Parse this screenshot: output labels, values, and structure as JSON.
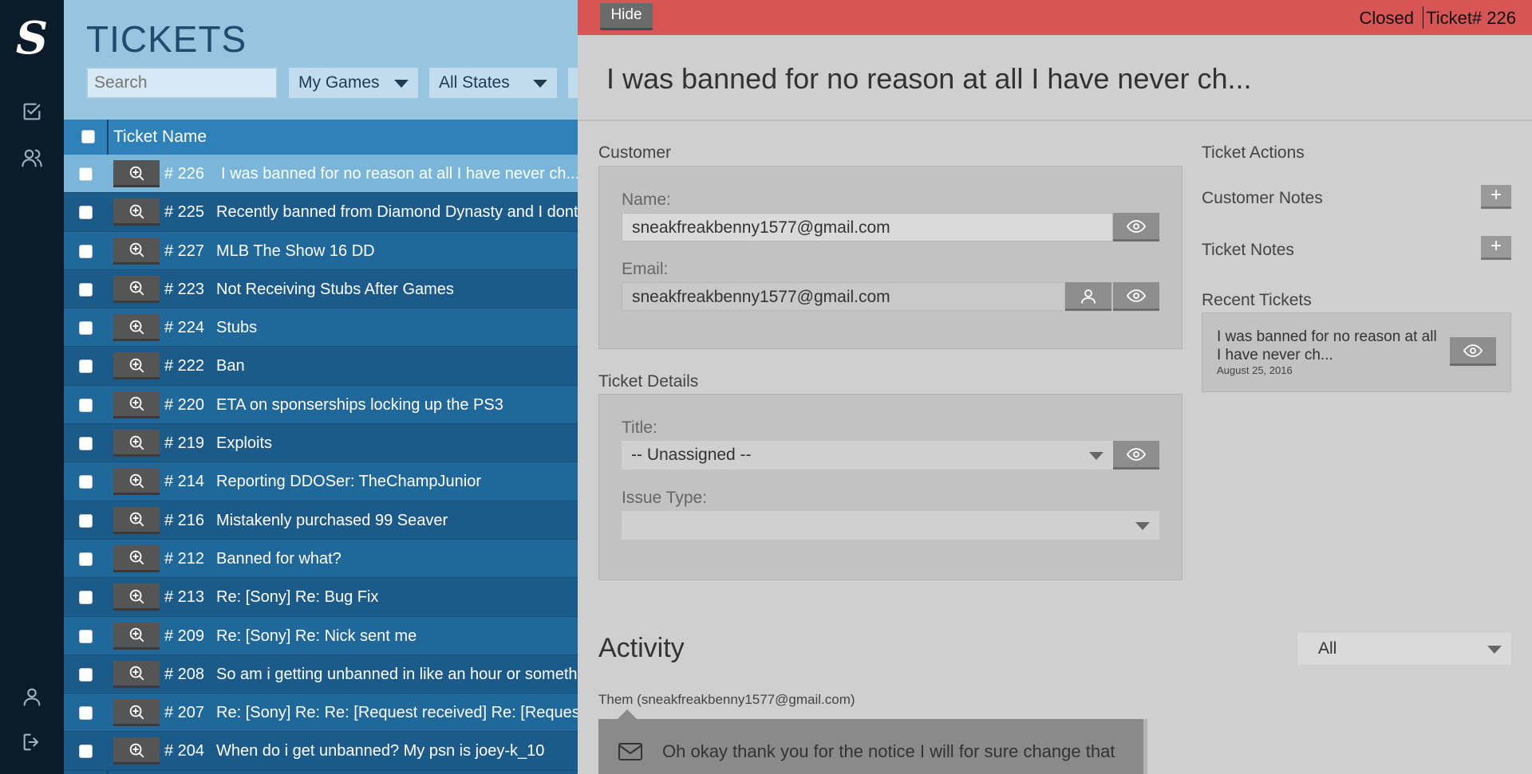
{
  "app": {
    "logo_letter": "S",
    "page_title": "TICKETS"
  },
  "colors": {
    "list_background": "#1c5f8e",
    "active_row": "#7ab6da",
    "header_bar": "#d85556",
    "panel_background": "#cfcfcf"
  },
  "sidebar": {
    "icons": [
      "tickets-icon",
      "users-icon",
      "profile-icon",
      "logout-icon"
    ]
  },
  "filters": {
    "search_placeholder": "Search",
    "games": "My Games",
    "states": "All States"
  },
  "table": {
    "column_header": "Ticket Name",
    "rows": [
      {
        "num": "# 226",
        "name": "I was banned for no reason at all I have never ch..."
      },
      {
        "num": "# 225",
        "name": "Recently banned from Diamond Dynasty and I dont"
      },
      {
        "num": "# 227",
        "name": "MLB The Show 16 DD"
      },
      {
        "num": "# 223",
        "name": "Not Receiving Stubs After Games"
      },
      {
        "num": "# 224",
        "name": "Stubs"
      },
      {
        "num": "# 222",
        "name": "Ban"
      },
      {
        "num": "# 220",
        "name": "ETA on sponserships locking up the PS3"
      },
      {
        "num": "# 219",
        "name": "Exploits"
      },
      {
        "num": "# 214",
        "name": "Reporting DDOSer: TheChampJunior"
      },
      {
        "num": "# 216",
        "name": "Mistakenly purchased 99 Seaver"
      },
      {
        "num": "# 212",
        "name": "Banned for what?"
      },
      {
        "num": "# 213",
        "name": "Re: [Sony] Re: Bug Fix"
      },
      {
        "num": "# 209",
        "name": "Re: [Sony] Re: Nick sent me"
      },
      {
        "num": "# 208",
        "name": "So am i getting unbanned in like an hour or someth"
      },
      {
        "num": "# 207",
        "name": "Re: [Sony] Re: Re: [Request received] Re: [Request"
      },
      {
        "num": "# 204",
        "name": "When do i get unbanned? My psn is joey-k_10"
      }
    ]
  },
  "detail": {
    "hide_label": "Hide",
    "status": "Closed",
    "ticket_number": "Ticket# 226",
    "title": "I was banned for no reason at all I have never ch...",
    "customer": {
      "section_label": "Customer",
      "name_label": "Name:",
      "name_value": "sneakfreakbenny1577@gmail.com",
      "email_label": "Email:",
      "email_value": "sneakfreakbenny1577@gmail.com"
    },
    "ticket_details": {
      "section_label": "Ticket Details",
      "title_label": "Title:",
      "title_value": "-- Unassigned --",
      "issue_type_label": "Issue Type:",
      "issue_type_value": ""
    },
    "actions": {
      "section_label": "Ticket Actions",
      "customer_notes": "Customer Notes",
      "ticket_notes": "Ticket Notes",
      "plus": "+"
    },
    "recent": {
      "section_label": "Recent Tickets",
      "title": "I was banned for no reason at all I have never ch...",
      "date": "August 25, 2016"
    },
    "activity": {
      "title": "Activity",
      "filter": "All",
      "from": "Them (sneakfreakbenny1577@gmail.com)",
      "message": "Oh okay thank you for the notice I will for sure change that"
    }
  }
}
